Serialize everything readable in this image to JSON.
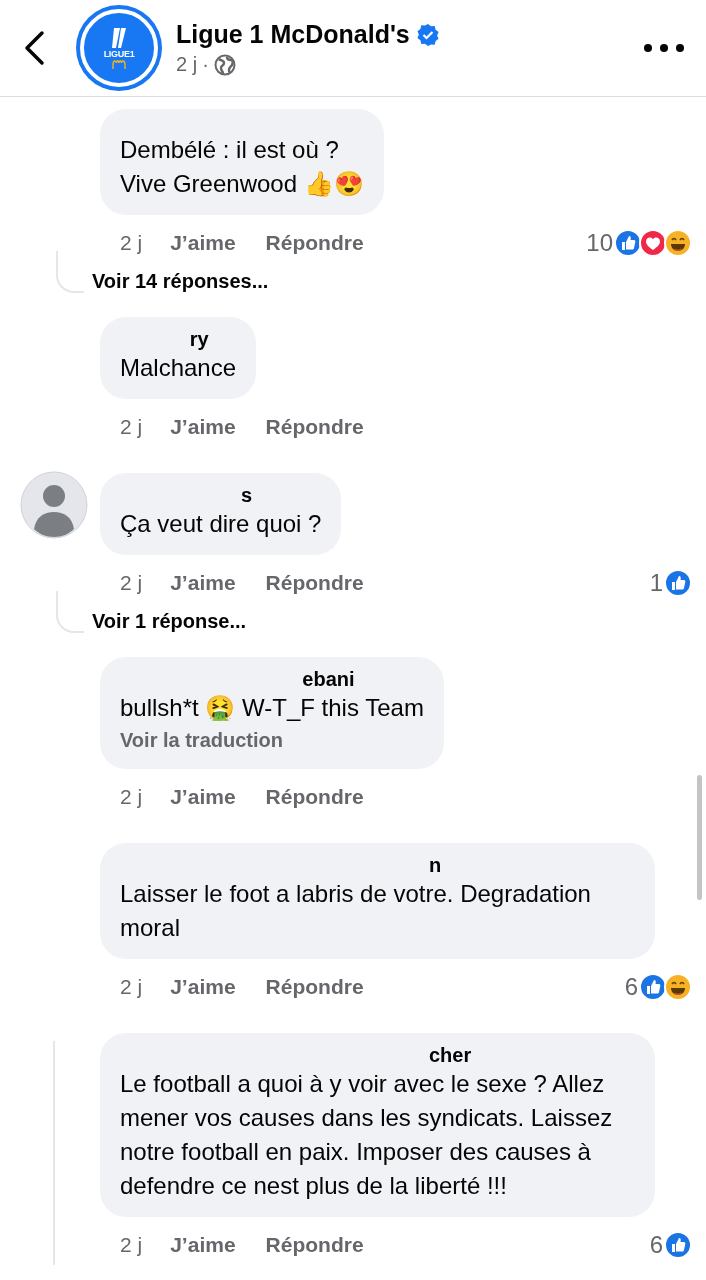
{
  "header": {
    "title": "Ligue 1 McDonald's",
    "verified": true,
    "time": "2 j",
    "separator": "·",
    "logo_text": "LIGUE1"
  },
  "comments": [
    {
      "text": "Dembélé : il est où ?\nVive Greenwood 👍😍",
      "time": "2 j",
      "like": "J’aime",
      "reply": "Répondre",
      "reactions": {
        "count": "10",
        "icons": [
          {
            "kind": "like"
          },
          {
            "kind": "love"
          },
          {
            "kind": "haha"
          }
        ]
      },
      "replies_link": "Voir 14 réponses..."
    },
    {
      "author": "ry",
      "text": "Malchance",
      "time": "2 j",
      "like": "J’aime",
      "reply": "Répondre"
    },
    {
      "avatar": {
        "kind": "default"
      },
      "author": "s",
      "text": "Ça veut dire quoi ?",
      "time": "2 j",
      "like": "J’aime",
      "reply": "Répondre",
      "reactions": {
        "count": "1",
        "icons": [
          {
            "kind": "like"
          }
        ]
      },
      "replies_link": "Voir 1 réponse..."
    },
    {
      "author": "ebani",
      "text": "bullsh*t 🤮 W-T_F this Team",
      "translate": "Voir la traduction",
      "time": "2 j",
      "like": "J’aime",
      "reply": "Répondre"
    },
    {
      "author": "n",
      "text": "Laisser le foot a labris de votre. Degradation moral",
      "time": "2 j",
      "like": "J’aime",
      "reply": "Répondre",
      "reactions": {
        "count": "6",
        "icons": [
          {
            "kind": "like"
          },
          {
            "kind": "haha"
          }
        ]
      }
    },
    {
      "author": "cher",
      "text": "Le football a quoi à y voir avec le sexe ? Allez mener vos causes dans les syndicats. Laissez notre football en paix. Imposer des causes à defendre ce nest plus de la liberté !!!",
      "time": "2 j",
      "like": "J’aime",
      "reply": "Répondre",
      "reactions": {
        "count": "6",
        "icons": [
          {
            "kind": "like"
          }
        ]
      },
      "thread_line": true
    }
  ]
}
